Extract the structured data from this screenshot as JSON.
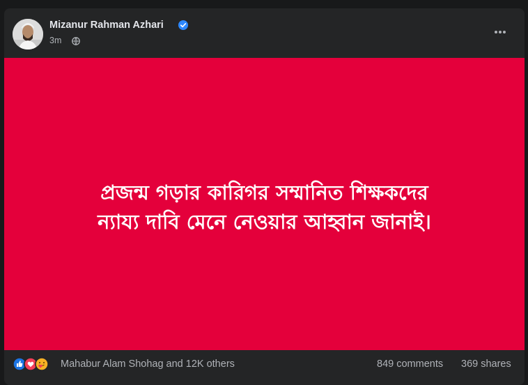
{
  "post": {
    "author": "Mizanur Rahman Azhari",
    "verified": true,
    "time": "3m",
    "audience_icon": "globe-icon",
    "more_icon": "more-options-icon"
  },
  "media": {
    "background": "#e4003b",
    "line1": "প্রজন্ম গড়ার কারিগর সম্মানিত শিক্ষকদের",
    "line2": "ন্যায্য দাবি মেনে নেওয়ার আহ্বান জানাই।"
  },
  "engagement": {
    "reaction_icons": [
      "like-icon",
      "love-icon",
      "care-icon"
    ],
    "reactors": "Mahabur Alam Shohag and 12K others",
    "comments": "849 comments",
    "shares": "369 shares"
  },
  "colors": {
    "page_bg": "#18191a",
    "card_bg": "#242526",
    "primary_text": "#e4e6eb",
    "secondary_text": "#b0b3b8",
    "verified_blue": "#2d88ff"
  }
}
